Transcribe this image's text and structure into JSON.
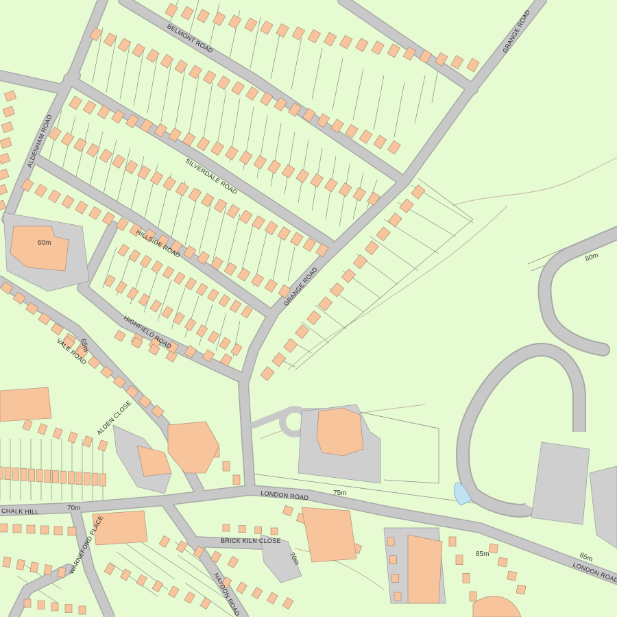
{
  "map": {
    "colors": {
      "background": "#e6fbd2",
      "road": "#c8c8c8",
      "road_edge": "#a9a9a9",
      "building": "#f8c49c",
      "plot_line": "#8a8a8a",
      "large_structure": "#cfcfcf",
      "water": "#bfe3f2",
      "contour": "#c8b49a"
    },
    "road_labels": {
      "belmont": "BELMONT ROAD",
      "grange_top": "GRANGE ROAD",
      "grange_mid": "GRANGE ROAD",
      "aldenham": "ALDENHAM ROAD",
      "silverdale": "SILVERDALE ROAD",
      "hillside": "HILLSIDE ROAD",
      "highfield": "HIGHFIELD ROAD",
      "vale": "VALE ROAD",
      "alden_close": "ALDEN CLOSE",
      "london_mid": "LONDON ROAD",
      "london_right": "LONDON ROAD",
      "chalk_hill": "CHALK HILL",
      "warneford": "WARNEFORD PLACE",
      "brick_kiln": "BRICK KILN CLOSE",
      "haydon": "HAYDON ROAD"
    },
    "height_labels": {
      "h60": "60m",
      "h65": "65m",
      "h70_left": "70m",
      "h75": "75m",
      "h70_mid": "70m",
      "h80": "80m",
      "h85_mid": "85m",
      "h85_right": "85m"
    }
  }
}
